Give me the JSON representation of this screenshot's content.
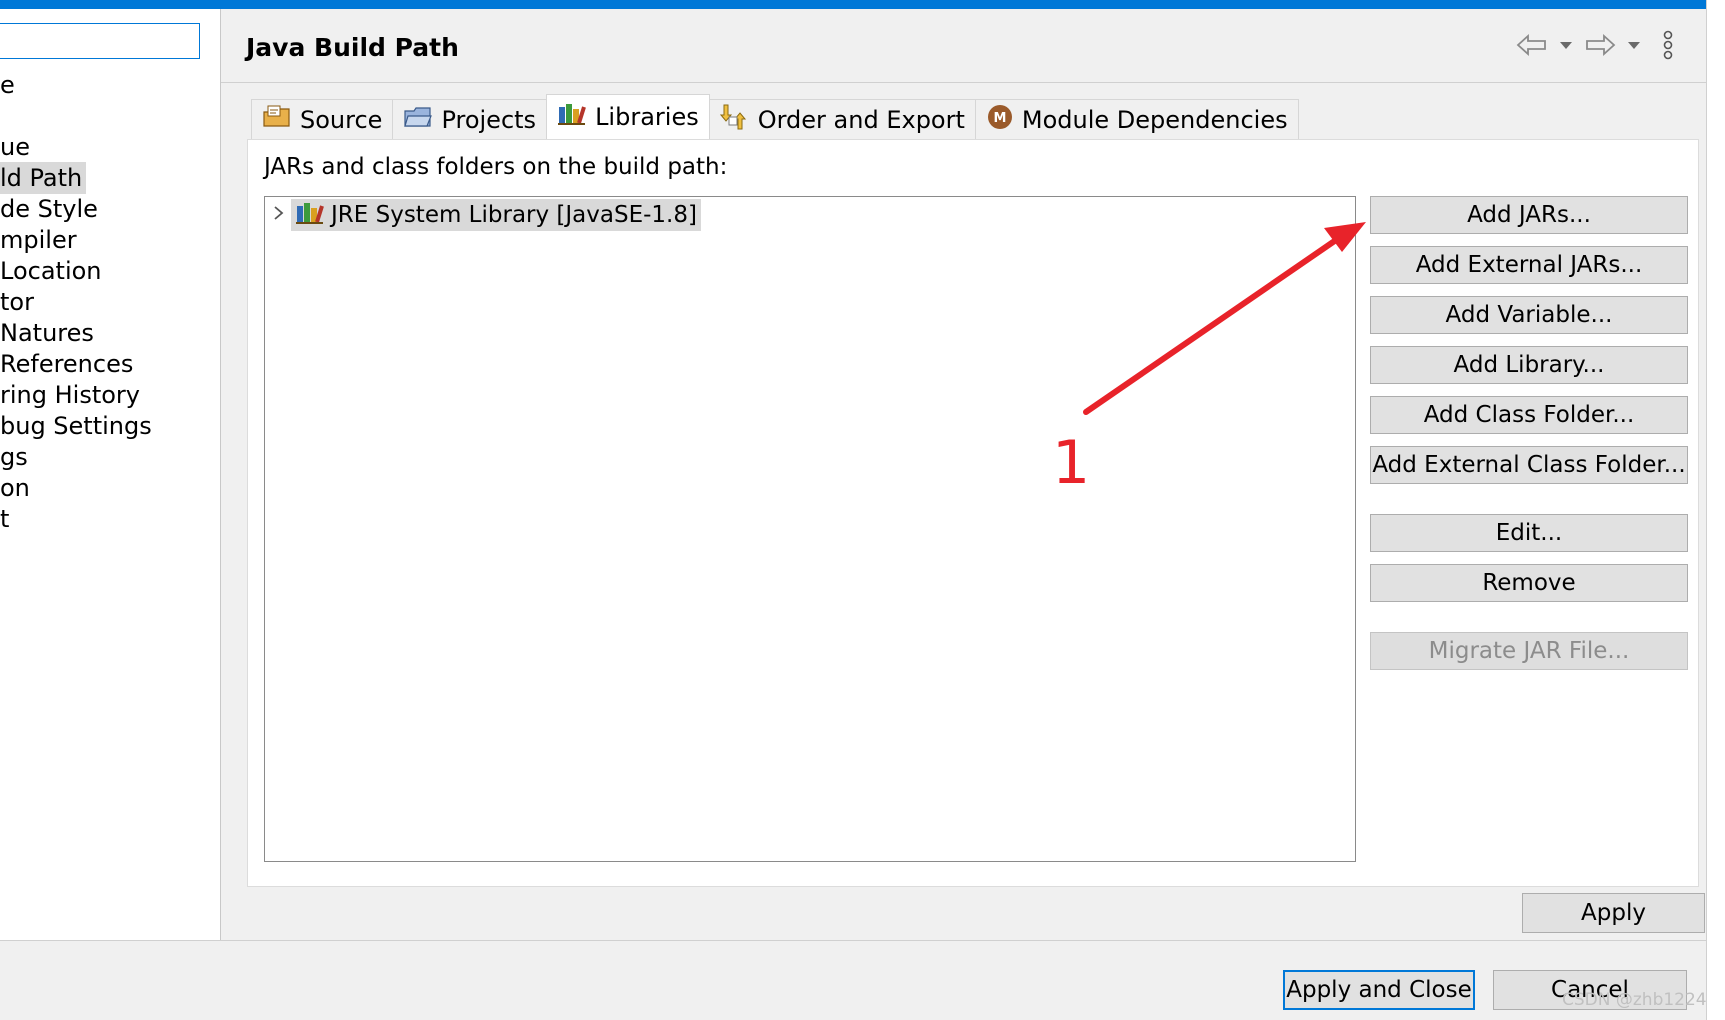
{
  "nav": {
    "filter_value": "",
    "items": [
      {
        "label": "e"
      },
      {
        "label": "ue"
      },
      {
        "label": "ld Path"
      },
      {
        "label": "de Style"
      },
      {
        "label": "mpiler"
      },
      {
        "label": " Location"
      },
      {
        "label": "tor"
      },
      {
        "label": "Natures"
      },
      {
        "label": "References"
      },
      {
        "label": "ring History"
      },
      {
        "label": "bug Settings"
      },
      {
        "label": "gs"
      },
      {
        "label": "on"
      },
      {
        "label": "t"
      }
    ]
  },
  "header": {
    "title": "Java Build Path"
  },
  "tabs": [
    {
      "label": "Source",
      "icon": "source-folder-icon"
    },
    {
      "label": "Projects",
      "icon": "projects-icon"
    },
    {
      "label": "Libraries",
      "icon": "libraries-icon"
    },
    {
      "label": "Order and Export",
      "icon": "order-export-icon"
    },
    {
      "label": "Module Dependencies",
      "icon": "module-icon"
    }
  ],
  "libraries": {
    "label": "JARs and class folders on the build path:",
    "entries": [
      {
        "label": "JRE System Library [JavaSE-1.8]"
      }
    ]
  },
  "buttons": {
    "add_jars": "Add JARs...",
    "add_external_jars": "Add External JARs...",
    "add_variable": "Add Variable...",
    "add_library": "Add Library...",
    "add_class_folder": "Add Class Folder...",
    "add_external_class_folder": "Add External Class Folder...",
    "edit": "Edit...",
    "remove": "Remove",
    "migrate_jar": "Migrate JAR File..."
  },
  "apply": "Apply",
  "footer": {
    "apply_close": "Apply and Close",
    "cancel": "Cancel"
  },
  "annotation": {
    "number": "1",
    "color": "#e8232a"
  },
  "watermark": "CSDN @zhb1224",
  "colors": {
    "accent": "#0078d7",
    "selection": "#d9d9d9"
  }
}
